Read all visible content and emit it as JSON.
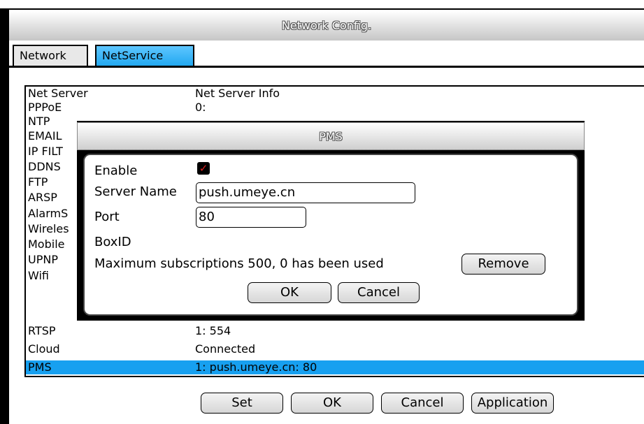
{
  "window": {
    "title": "Network Config."
  },
  "tabs": [
    {
      "label": "Network",
      "active": false
    },
    {
      "label": "NetService",
      "active": true
    }
  ],
  "service_list": {
    "header": {
      "col1": "Net Server",
      "col2": "Net Server Info"
    },
    "rows": [
      {
        "name": "PPPoE",
        "info": "0:"
      },
      {
        "name": "NTP",
        "info": ""
      },
      {
        "name": "EMAIL",
        "info": ""
      },
      {
        "name": "IP FILT",
        "info": ""
      },
      {
        "name": "DDNS",
        "info": ""
      },
      {
        "name": "FTP",
        "info": ""
      },
      {
        "name": "ARSP",
        "info": ""
      },
      {
        "name": "AlarmS",
        "info": ""
      },
      {
        "name": "Wireles",
        "info": ""
      },
      {
        "name": "Mobile",
        "info": ""
      },
      {
        "name": "UPNP",
        "info": ""
      },
      {
        "name": "Wifi",
        "info": ""
      },
      {
        "name": "RTSP",
        "info": "1: 554"
      },
      {
        "name": "Cloud",
        "info": "Connected"
      },
      {
        "name": "PMS",
        "info": "1: push.umeye.cn: 80",
        "selected": true
      }
    ]
  },
  "bottom_buttons": {
    "set": "Set",
    "ok": "OK",
    "cancel": "Cancel",
    "application": "Application"
  },
  "pms_dialog": {
    "title": "PMS",
    "enable_label": "Enable",
    "enable_checked": true,
    "server_name_label": "Server Name",
    "server_name_value": "push.umeye.cn",
    "port_label": "Port",
    "port_value": "80",
    "boxid_label": "BoxID",
    "subscriptions_text": "Maximum subscriptions 500, 0 has been used",
    "remove_label": "Remove",
    "ok_label": "OK",
    "cancel_label": "Cancel"
  },
  "colors": {
    "accent": "#17a0f0",
    "check": "#e02020"
  }
}
